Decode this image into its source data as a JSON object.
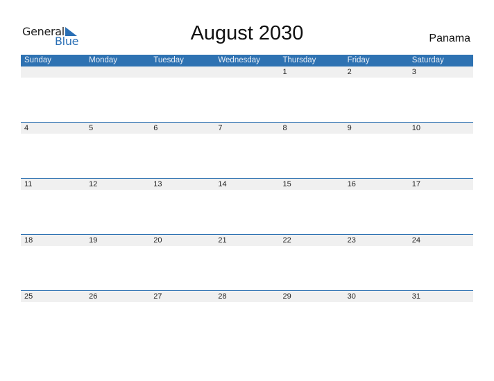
{
  "logo": {
    "general": "General",
    "blue": "Blue"
  },
  "title": "August 2030",
  "country": "Panama",
  "weekdays": [
    "Sunday",
    "Monday",
    "Tuesday",
    "Wednesday",
    "Thursday",
    "Friday",
    "Saturday"
  ],
  "weeks": [
    [
      "",
      "",
      "",
      "",
      "1",
      "2",
      "3"
    ],
    [
      "4",
      "5",
      "6",
      "7",
      "8",
      "9",
      "10"
    ],
    [
      "11",
      "12",
      "13",
      "14",
      "15",
      "16",
      "17"
    ],
    [
      "18",
      "19",
      "20",
      "21",
      "22",
      "23",
      "24"
    ],
    [
      "25",
      "26",
      "27",
      "28",
      "29",
      "30",
      "31"
    ]
  ],
  "colors": {
    "accent": "#2e72b2",
    "date_strip": "#f0f0f0"
  }
}
